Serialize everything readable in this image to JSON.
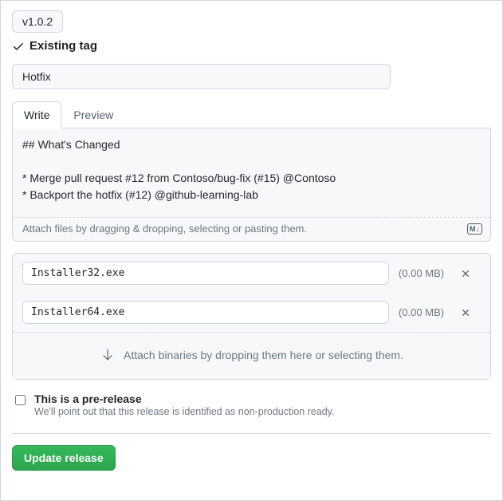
{
  "tag": {
    "value": "v1.0.2",
    "existing_label": "Existing tag"
  },
  "release": {
    "title": "Hotfix"
  },
  "tabs": {
    "write": "Write",
    "preview": "Preview"
  },
  "description": {
    "value": "## What's Changed\n\n* Merge pull request #12 from Contoso/bug-fix (#15) @Contoso\n* Backport the hotfix (#12) @github-learning-lab",
    "attach_hint": "Attach files by dragging & dropping, selecting or pasting them."
  },
  "assets": [
    {
      "name": "Installer32.exe",
      "size": "(0.00 MB)"
    },
    {
      "name": "Installer64.exe",
      "size": "(0.00 MB)"
    }
  ],
  "drop_zone_hint": "Attach binaries by dropping them here or selecting them.",
  "prerelease": {
    "label": "This is a pre-release",
    "sub": "We'll point out that this release is identified as non-production ready."
  },
  "actions": {
    "update": "Update release"
  },
  "md_icon": "M↓"
}
